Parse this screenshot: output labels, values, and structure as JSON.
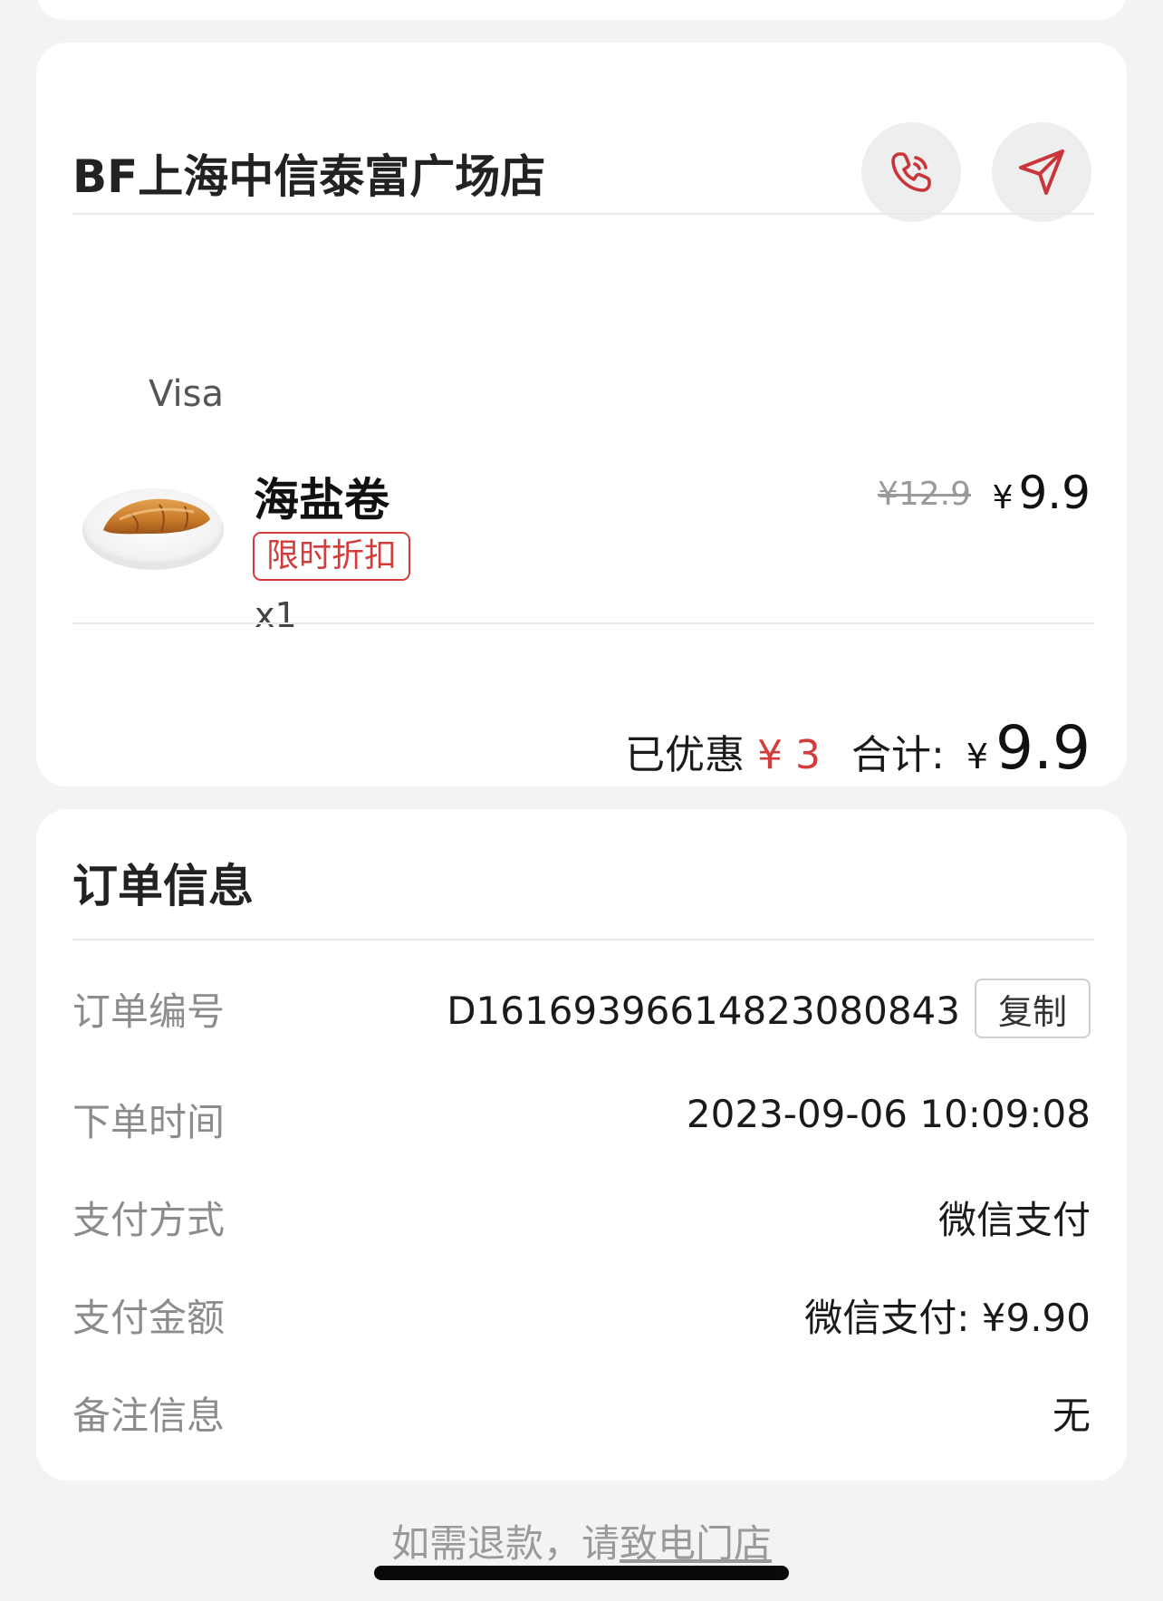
{
  "store": {
    "name": "BF上海中信泰富广场店",
    "call_icon": "phone-icon",
    "nav_icon": "navigation-arrow-icon",
    "accent_color": "#c8353a"
  },
  "order_item": {
    "payment_brand": "Visa",
    "name": "海盐卷",
    "promo_tag": "限时折扣",
    "quantity": "x1",
    "original_price": "¥12.9",
    "currency": "¥",
    "price": "9.9",
    "image_icon": "salt-bread-roll-image"
  },
  "summary": {
    "discount_label": "已优惠",
    "discount_value": "¥ 3",
    "total_label": "合计:",
    "currency": "¥",
    "total_value": "9.9"
  },
  "order_info": {
    "title": "订单信息",
    "rows": [
      {
        "label": "订单编号",
        "value": "D1616939661482308084​3"
      },
      {
        "label": "下单时间",
        "value": "2023-09-06 10:09:08"
      },
      {
        "label": "支付方式",
        "value": "微信支付"
      },
      {
        "label": "支付金额",
        "value": "微信支付: ¥9.90"
      },
      {
        "label": "备注信息",
        "value": "无"
      }
    ],
    "copy_label": "复制"
  },
  "footer": {
    "refund_prefix": "如需退款，请",
    "refund_link": "致电门店"
  }
}
